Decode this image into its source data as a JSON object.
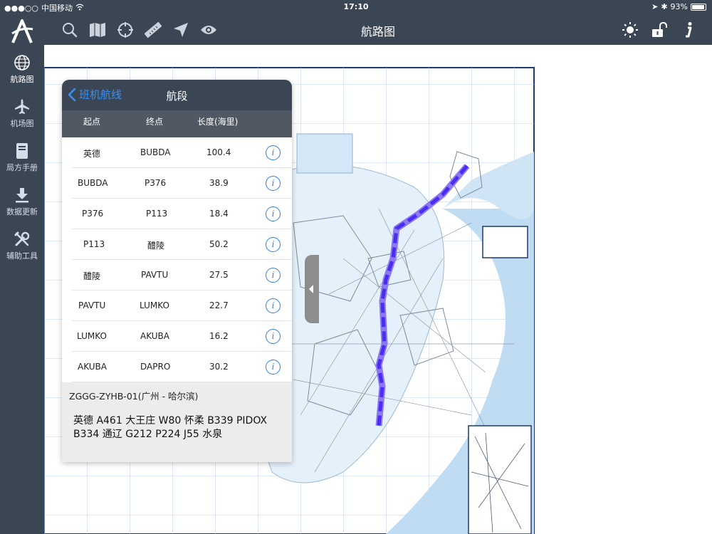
{
  "status_bar": {
    "carrier": "中国移动",
    "time": "17:10",
    "battery": "93%",
    "battery_level": 0.93
  },
  "toolbar": {
    "title": "航路图",
    "tools": [
      "search-icon",
      "map-icon",
      "crosshair-icon",
      "ruler-icon",
      "navigation-arrow-icon",
      "eye-icon"
    ],
    "right_tools": [
      "brightness-icon",
      "unlock-icon",
      "info-icon"
    ]
  },
  "sidebar": {
    "items": [
      {
        "label": "航路图",
        "icon": "globe-icon"
      },
      {
        "label": "机场图",
        "icon": "airplane-icon"
      },
      {
        "label": "局方手册",
        "icon": "manual-icon"
      },
      {
        "label": "数据更新",
        "icon": "download-icon"
      },
      {
        "label": "辅助工具",
        "icon": "tools-icon"
      }
    ]
  },
  "panel": {
    "back_label": "班机航线",
    "title": "航段",
    "columns": [
      "起点",
      "终点",
      "长度(海里)"
    ],
    "rows": [
      {
        "from": "英德",
        "to": "BUBDA",
        "length": "100.4"
      },
      {
        "from": "BUBDA",
        "to": "P376",
        "length": "38.9"
      },
      {
        "from": "P376",
        "to": "P113",
        "length": "18.4"
      },
      {
        "from": "P113",
        "to": "醴陵",
        "length": "50.2"
      },
      {
        "from": "醴陵",
        "to": "PAVTU",
        "length": "27.5"
      },
      {
        "from": "PAVTU",
        "to": "LUMKO",
        "length": "22.7"
      },
      {
        "from": "LUMKO",
        "to": "AKUBA",
        "length": "16.2"
      },
      {
        "from": "AKUBA",
        "to": "DAPRO",
        "length": "30.2"
      }
    ],
    "route_code": "ZGGG-ZYHB-01(广州 - 哈尔滨)",
    "route_text": "英德 A461 大王庄 W80 怀柔 B339 PIDOX B334 通辽 G212 P224 J55 水泉"
  },
  "colors": {
    "bar": "#3b4654",
    "accent": "#2f7fe0",
    "route": "#4a2ef0"
  }
}
